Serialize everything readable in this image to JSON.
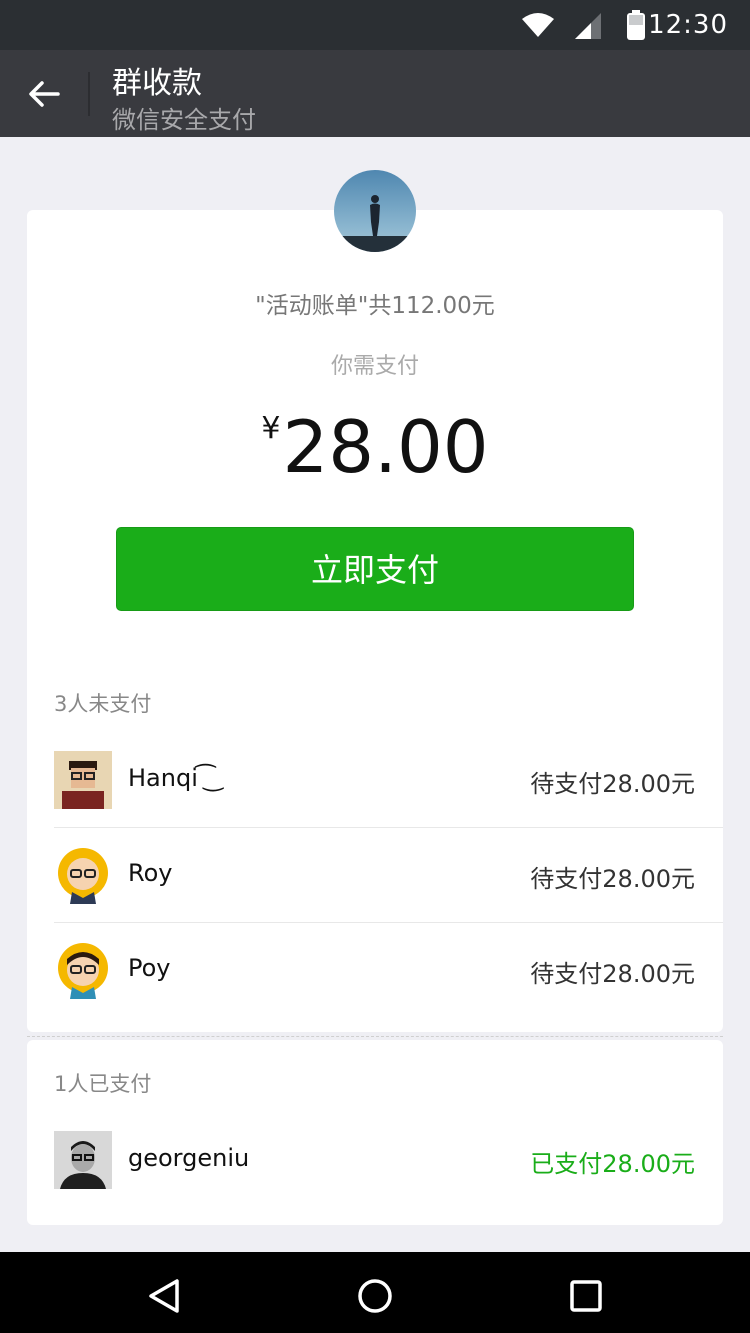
{
  "status_bar": {
    "time": "12:30"
  },
  "header": {
    "title": "群收款",
    "subtitle": "微信安全支付"
  },
  "bill": {
    "description": "\"活动账单\"共112.00元",
    "need_label": "你需支付",
    "currency": "¥",
    "amount": "28.00",
    "pay_button": "立即支付"
  },
  "unpaid": {
    "label": "3人未支付",
    "members": [
      {
        "name": "Hanqi ͡ ͜",
        "status": "待支付28.00元"
      },
      {
        "name": "Roy",
        "status": "待支付28.00元"
      },
      {
        "name": "Poy",
        "status": "待支付28.00元"
      }
    ]
  },
  "paid": {
    "label": "1人已支付",
    "members": [
      {
        "name": "georgeniu",
        "status": "已支付28.00元"
      }
    ]
  },
  "colors": {
    "accent": "#1aad19",
    "appbar": "#393a3f",
    "statusbar": "#2b2f33"
  },
  "icons": [
    "wifi-icon",
    "signal-icon",
    "battery-icon",
    "back-arrow-icon",
    "nav-back-icon",
    "nav-home-icon",
    "nav-recents-icon"
  ]
}
